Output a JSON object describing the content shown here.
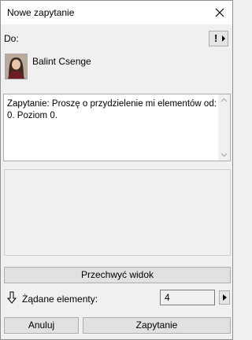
{
  "window": {
    "title": "Nowe zapytanie"
  },
  "to": {
    "label": "Do:"
  },
  "priority": {
    "symbol": "!"
  },
  "recipient": {
    "name": "Balint Csenge"
  },
  "message": {
    "text": "Zapytanie: Proszę o przydzielenie mi elementów od: 0. Poziom 0."
  },
  "actions": {
    "capture_view": "Przechwyć widok",
    "requested_label": "Żądane elementy:",
    "requested_value": "4",
    "cancel": "Anuluj",
    "submit": "Zapytanie"
  },
  "icons": {
    "close": "close-icon",
    "priority": "exclamation-icon",
    "requested": "down-arrow-icon",
    "stepper": "triangle-right-icon"
  }
}
